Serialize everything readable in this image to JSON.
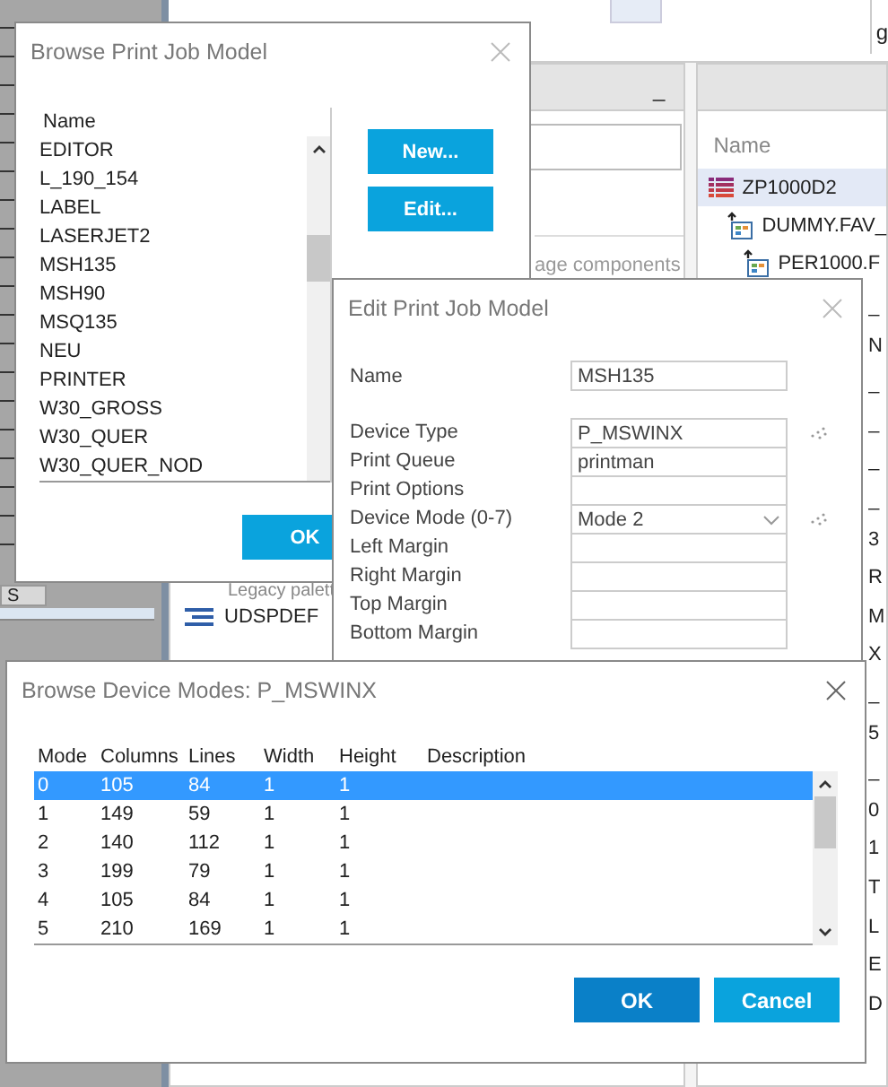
{
  "background_app": {
    "tab_fragment": "g",
    "panel_minimize": "_",
    "panel_text": "age components",
    "left_edge_fragment": "S",
    "palette_items": [
      {
        "kind": "caption",
        "name": "Legacy palett"
      },
      {
        "kind": "item",
        "name": "UDSPDEF"
      }
    ],
    "tree": {
      "column": "Name",
      "items": [
        {
          "name": "ZP1000D2",
          "kind": "list",
          "selected": true,
          "children": [
            {
              "name": "DUMMY.FAV_",
              "kind": "document",
              "selected": false,
              "children": [
                {
                  "name": "PER1000.F",
                  "kind": "document",
                  "selected": false
                }
              ]
            }
          ]
        }
      ]
    },
    "tree_fragments": [
      "_",
      "N",
      "_",
      "_",
      "_",
      "_",
      "3",
      "R",
      "M",
      "X",
      "_",
      "5",
      "_",
      "0",
      "1",
      "T",
      "L",
      "E",
      "D"
    ]
  },
  "browse_print_job_model": {
    "title": "Browse Print Job Model",
    "column": "Name",
    "items": [
      {
        "name": "EDITOR",
        "selected": false
      },
      {
        "name": "L_190_154",
        "selected": false
      },
      {
        "name": "LABEL",
        "selected": false
      },
      {
        "name": "LASERJET2",
        "selected": false
      },
      {
        "name": "MSH135",
        "selected": false
      },
      {
        "name": "MSH90",
        "selected": false
      },
      {
        "name": "MSQ135",
        "selected": false
      },
      {
        "name": "NEU",
        "selected": false
      },
      {
        "name": "PRINTER",
        "selected": false
      },
      {
        "name": "W30_GROSS",
        "selected": false
      },
      {
        "name": "W30_QUER",
        "selected": false
      },
      {
        "name": "W30_QUER_NOD",
        "selected": false
      }
    ],
    "buttons": [
      "New...",
      "Edit..."
    ],
    "ok": "OK"
  },
  "edit_print_job_model": {
    "title": "Edit Print Job Model",
    "fields": [
      {
        "label": "Name",
        "value": "MSH135",
        "kind": "text",
        "lookup": false
      },
      {
        "label": "Device Type",
        "value": "P_MSWINX",
        "kind": "text",
        "lookup": true
      },
      {
        "label": "Print Queue",
        "value": "printman",
        "kind": "text",
        "lookup": false
      },
      {
        "label": "Print Options",
        "kind": "text",
        "lookup": false
      },
      {
        "label": "Device Mode (0-7)",
        "value": "Mode 2",
        "kind": "select",
        "lookup": true
      },
      {
        "label": "Left Margin",
        "kind": "text",
        "lookup": false
      },
      {
        "label": "Right Margin",
        "kind": "text",
        "lookup": false
      },
      {
        "label": "Top Margin",
        "kind": "text",
        "lookup": false
      },
      {
        "label": "Bottom Margin",
        "kind": "text",
        "lookup": false
      }
    ]
  },
  "browse_device_modes": {
    "title": "Browse Device Modes: P_MSWINX",
    "columns": [
      "Mode",
      "Columns",
      "Lines",
      "Width",
      "Height",
      "Description"
    ],
    "rows": [
      {
        "cells": [
          "0",
          "105",
          "84",
          "1",
          "1"
        ],
        "selected": true
      },
      {
        "cells": [
          "1",
          "149",
          "59",
          "1",
          "1"
        ],
        "selected": false
      },
      {
        "cells": [
          "2",
          "140",
          "112",
          "1",
          "1"
        ],
        "selected": false
      },
      {
        "cells": [
          "3",
          "199",
          "79",
          "1",
          "1"
        ],
        "selected": false
      },
      {
        "cells": [
          "4",
          "105",
          "84",
          "1",
          "1"
        ],
        "selected": false
      },
      {
        "cells": [
          "5",
          "210",
          "169",
          "1",
          "1"
        ],
        "selected": false
      }
    ],
    "buttons": [
      {
        "label": "OK",
        "kind": "primary"
      },
      {
        "label": "Cancel",
        "kind": "secondary"
      }
    ]
  }
}
